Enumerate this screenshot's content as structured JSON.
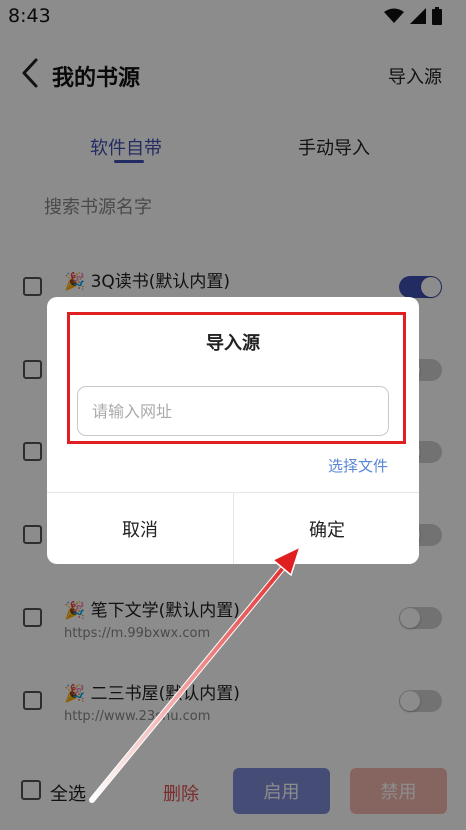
{
  "status_bar": {
    "time": "8:43"
  },
  "app_bar": {
    "title": "我的书源",
    "import_action": "导入源"
  },
  "tabs": [
    {
      "label": "软件自带",
      "active": true
    },
    {
      "label": "手动导入",
      "active": false
    }
  ],
  "search": {
    "placeholder": "搜索书源名字"
  },
  "sources": [
    {
      "name": "🎉 3Q读书(默认内置)",
      "url": "",
      "enabled": true
    },
    {
      "name": "",
      "url": "",
      "enabled": false
    },
    {
      "name": "",
      "url": "",
      "enabled": false
    },
    {
      "name": "",
      "url": "",
      "enabled": false
    },
    {
      "name": "🎉 笔下文学(默认内置)",
      "url": "https://m.99bxwx.com",
      "enabled": false
    },
    {
      "name": "🎉 二三书屋(默认内置)",
      "url": "http://www.23shu.com",
      "enabled": false
    }
  ],
  "bottom_bar": {
    "select_all": "全选",
    "delete": "删除",
    "enable": "启用",
    "disable": "禁用"
  },
  "dialog": {
    "title": "导入源",
    "input_placeholder": "请输入网址",
    "input_value": "",
    "select_file": "选择文件",
    "cancel": "取消",
    "confirm": "确定"
  },
  "colors": {
    "accent": "#3f51b5",
    "danger": "#e05050",
    "link": "#5a86d8",
    "annotation": "#e02020"
  }
}
